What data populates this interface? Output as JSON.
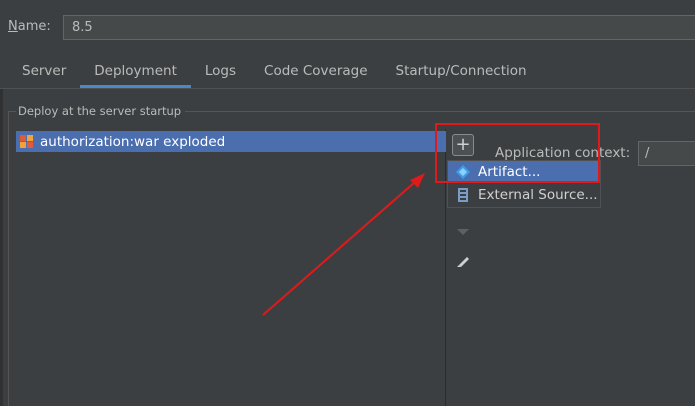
{
  "name_field": {
    "label": "Name:",
    "label_mnemonic": "N",
    "label_rest": "ame:",
    "value": "8.5"
  },
  "tabs": [
    {
      "label": "Server",
      "active": false
    },
    {
      "label": "Deployment",
      "active": true
    },
    {
      "label": "Logs",
      "active": false
    },
    {
      "label": "Code Coverage",
      "active": false
    },
    {
      "label": "Startup/Connection",
      "active": false
    }
  ],
  "deploy_group": {
    "title": "Deploy at the server startup",
    "items": [
      {
        "label": "authorization:war exploded",
        "icon": "war-exploded-icon",
        "selected": true
      }
    ]
  },
  "toolbar": {
    "add_label": "+",
    "icons": [
      "plus-icon",
      "arrow-down-icon",
      "pencil-icon"
    ]
  },
  "popup_menu": {
    "items": [
      {
        "label": "Artifact...",
        "icon": "artifact-icon",
        "selected": true
      },
      {
        "label": "External Source...",
        "icon": "external-source-icon",
        "selected": false
      }
    ]
  },
  "app_context": {
    "label": "Application context:",
    "value": "/"
  },
  "colors": {
    "background": "#3c3f41",
    "selection": "#4b6eaf",
    "tab_underline": "#4a88c7",
    "annotation_red": "#e01a1a",
    "artifact_blue": "#3d9ee8"
  }
}
